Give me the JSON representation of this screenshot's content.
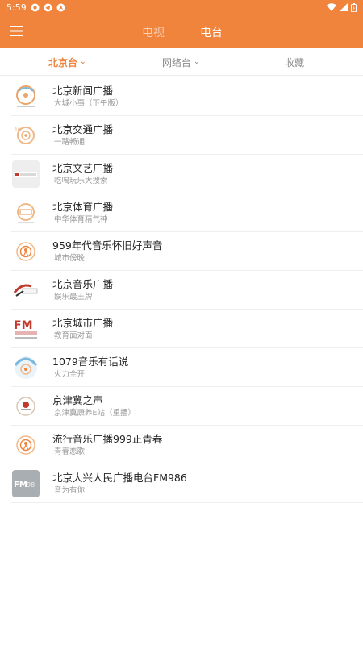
{
  "status_bar": {
    "time": "5:59",
    "icons": [
      "record-icon",
      "telegram-icon",
      "navigation-icon",
      "wifi-icon",
      "signal-icon",
      "battery-icon"
    ]
  },
  "header": {
    "tabs": [
      {
        "label": "电视",
        "active": false
      },
      {
        "label": "电台",
        "active": true
      }
    ],
    "accent_color": "#f0843c"
  },
  "subtabs": [
    {
      "label": "北京台",
      "active": true,
      "has_caret": true
    },
    {
      "label": "网络台",
      "active": false,
      "has_caret": true
    },
    {
      "label": "收藏",
      "active": false,
      "has_caret": false
    }
  ],
  "stations": [
    {
      "name": "北京新闻广播",
      "subtitle": "大城小事（下午版）",
      "logo": "station-logo"
    },
    {
      "name": "北京交通广播",
      "subtitle": "一路畅通",
      "logo": "station-logo"
    },
    {
      "name": "北京文艺广播",
      "subtitle": "吃喝玩乐大搜索",
      "logo": "station-logo"
    },
    {
      "name": "北京体育广播",
      "subtitle": "中华体育精气神",
      "logo": "station-logo"
    },
    {
      "name": "959年代音乐怀旧好声音",
      "subtitle": "城市傍晚",
      "logo": "radio-icon"
    },
    {
      "name": "北京音乐广播",
      "subtitle": "娱乐最王牌",
      "logo": "station-logo"
    },
    {
      "name": "北京城市广播",
      "subtitle": "教育面对面",
      "logo": "station-logo"
    },
    {
      "name": "1079音乐有话说",
      "subtitle": "火力全开",
      "logo": "station-logo"
    },
    {
      "name": "京津冀之声",
      "subtitle": "京津冀康养E站（重播）",
      "logo": "station-logo"
    },
    {
      "name": "流行音乐广播999正青春",
      "subtitle": "青春恋歌",
      "logo": "radio-icon"
    },
    {
      "name": "北京大兴人民广播电台FM986",
      "subtitle": "音为有你",
      "logo": "station-logo"
    }
  ]
}
